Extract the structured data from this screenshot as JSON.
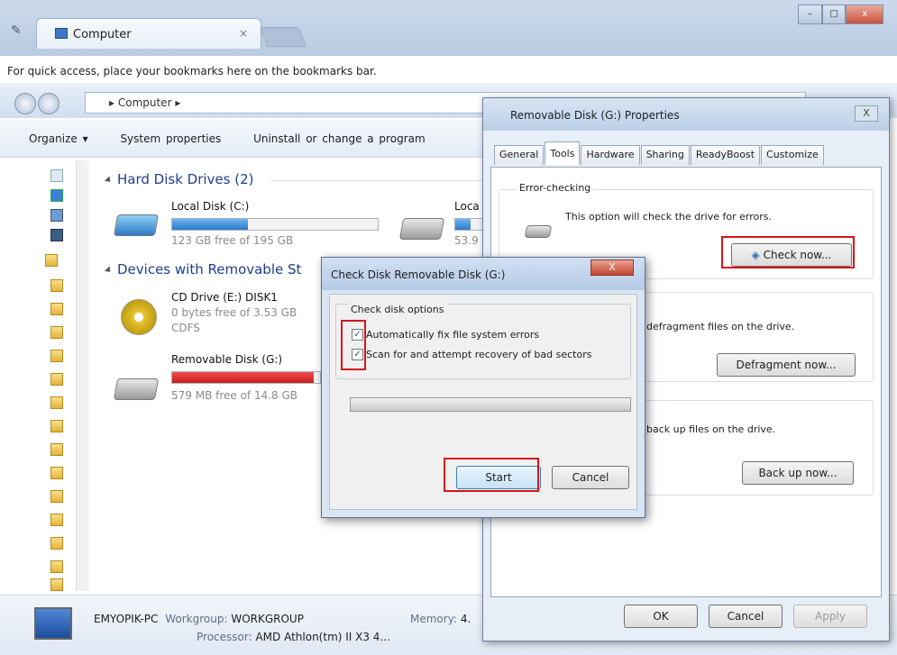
{
  "browser": {
    "tab_title": "Computer",
    "tab_close": "×",
    "bookmark_bar_text": "For quick access, place your bookmarks here on the bookmarks bar."
  },
  "explorer": {
    "breadcrumb": "Computer",
    "toolbar": {
      "organize": "Organize ▾",
      "system_properties": "System properties",
      "uninstall": "Uninstall or change a program"
    },
    "hard_disk_group": "Hard Disk Drives (2)",
    "removable_group": "Devices with Removable St",
    "drives": [
      {
        "name": "Local Disk (C:)",
        "free": "123 GB free of 195 GB",
        "used_fraction": 0.37
      },
      {
        "name": "Loca",
        "free": "53.9",
        "used_fraction": 0.5
      },
      {
        "name": "CD Drive (E:) DISK1",
        "free": "0 bytes free of 3.53 GB",
        "fs": "CDFS"
      },
      {
        "name": "Removable Disk (G:)",
        "free": "579 MB free of 14.8 GB",
        "used_fraction": 0.96
      }
    ],
    "details": {
      "pc_name": "EMYOPIK-PC",
      "workgroup_label": "Workgroup:",
      "workgroup": "WORKGROUP",
      "memory_label": "Memory:",
      "memory": "4.",
      "processor_label": "Processor:",
      "processor": "AMD Athlon(tm) II X3 4..."
    }
  },
  "properties_dialog": {
    "title": "Removable Disk (G:) Properties",
    "close": "X",
    "tabs": [
      "General",
      "Tools",
      "Hardware",
      "Sharing",
      "ReadyBoost",
      "Customize"
    ],
    "active_tab": "Tools",
    "error_checking": {
      "group": "Error-checking",
      "text": "This option will check the drive for errors.",
      "button": "Check now..."
    },
    "defrag": {
      "text": "defragment files on the drive.",
      "button": "Defragment now..."
    },
    "backup": {
      "text": "back up files on the drive.",
      "button": "Back up now..."
    },
    "ok": "OK",
    "cancel": "Cancel",
    "apply": "Apply"
  },
  "check_disk_dialog": {
    "title": "Check Disk Removable Disk (G:)",
    "close": "X",
    "group": "Check disk options",
    "option1": "Automatically fix file system errors",
    "option2": "Scan for and attempt recovery of bad sectors",
    "check_mark": "✓",
    "progress": 0,
    "start": "Start",
    "cancel": "Cancel"
  },
  "colors": {
    "highlight": "#d7141b",
    "drive_bar": "#2a7ac9",
    "drive_bar_full": "#c81d1d"
  }
}
